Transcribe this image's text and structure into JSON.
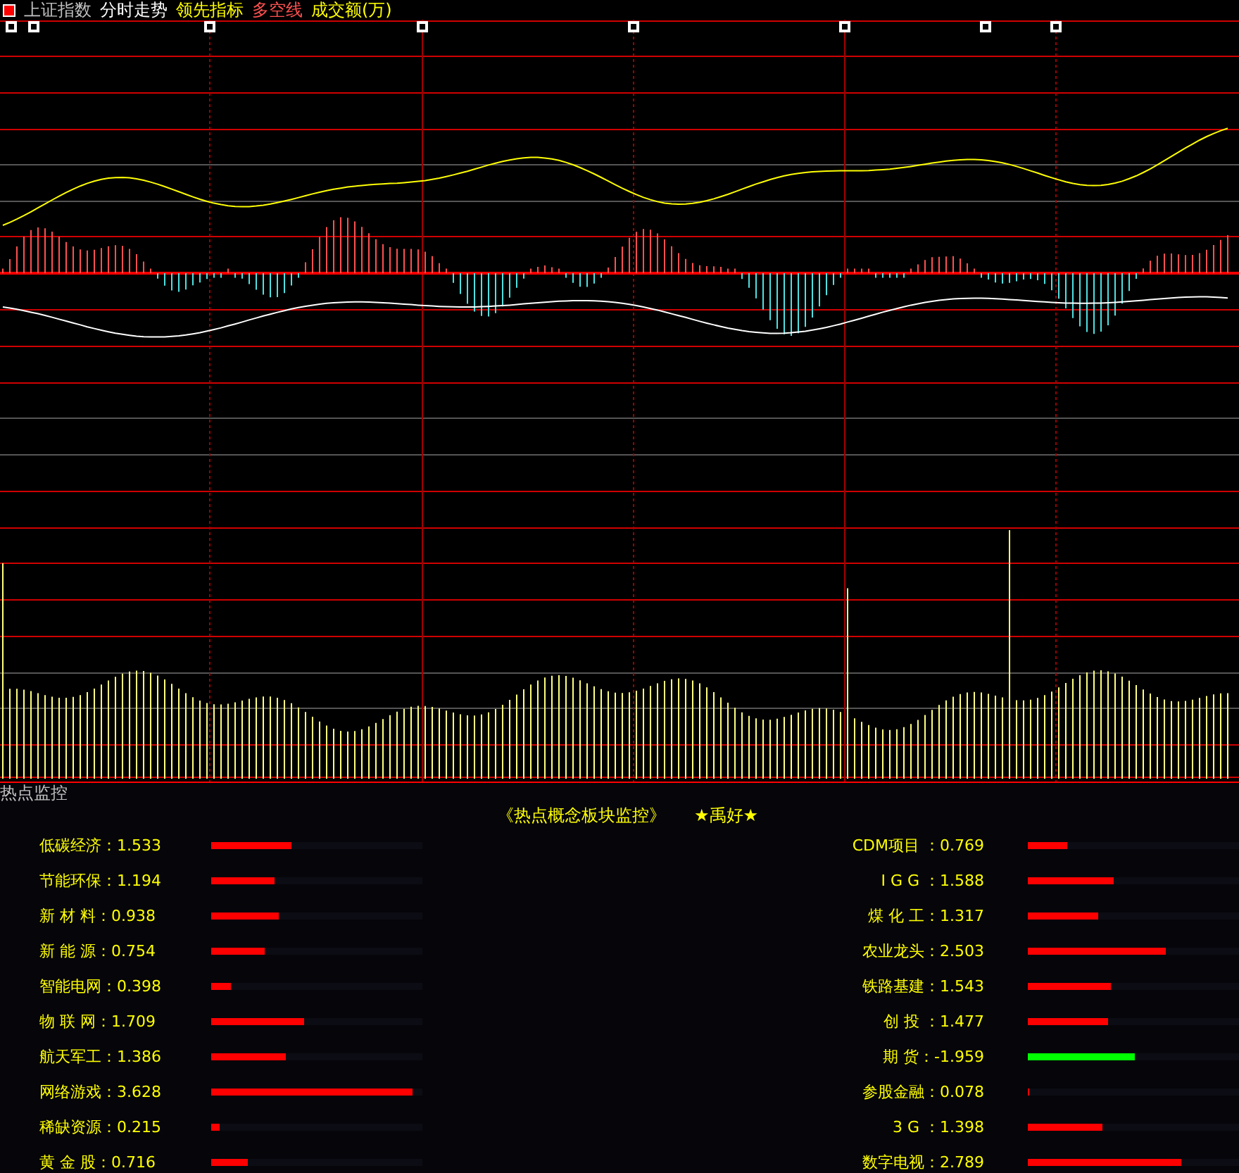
{
  "header": {
    "items": [
      {
        "label": "上证指数",
        "color": "#c0c0c0"
      },
      {
        "label": "分时走势",
        "color": "#ffffff"
      },
      {
        "label": "领先指标",
        "color": "#ffff00"
      },
      {
        "label": "多空线",
        "color": "#ff5050"
      },
      {
        "label": "成交额(万)",
        "color": "#ffff00"
      }
    ]
  },
  "monitor": {
    "title": "热点监控",
    "heading": "《热点概念板块监控》",
    "signature": "★禹好★",
    "left": [
      {
        "text": "低碳经济：1.533",
        "level": 0.383,
        "color": "#ff0000"
      },
      {
        "text": "节能环保：1.194",
        "level": 0.3,
        "color": "#ff0000"
      },
      {
        "text": "新 材 料：0.938",
        "level": 0.32,
        "color": "#ff0000"
      },
      {
        "text": "新 能 源：0.754",
        "level": 0.25,
        "color": "#ff0000"
      },
      {
        "text": "智能电网：0.398",
        "level": 0.093,
        "color": "#ff0000"
      },
      {
        "text": "物 联 网：1.709",
        "level": 0.44,
        "color": "#ff0000"
      },
      {
        "text": "航天军工：1.386",
        "level": 0.353,
        "color": "#ff0000"
      },
      {
        "text": "网络游戏：3.628",
        "level": 0.953,
        "color": "#ff0000"
      },
      {
        "text": "稀缺资源：0.215",
        "level": 0.04,
        "color": "#ff0000"
      },
      {
        "text": "黄 金 股：0.716",
        "level": 0.173,
        "color": "#ff0000"
      }
    ],
    "right": [
      {
        "text": "CDM项目 ：0.769",
        "level": 0.187,
        "color": "#ff0000"
      },
      {
        "text": "I G G ：1.588",
        "level": 0.407,
        "color": "#ff0000"
      },
      {
        "text": "煤 化 工：1.317",
        "level": 0.333,
        "color": "#ff0000"
      },
      {
        "text": "农业龙头：2.503",
        "level": 0.653,
        "color": "#ff0000"
      },
      {
        "text": "铁路基建：1.543",
        "level": 0.393,
        "color": "#ff0000"
      },
      {
        "text": "创 投 ：1.477",
        "level": 0.38,
        "color": "#ff0000"
      },
      {
        "text": "期 货：-1.959",
        "level": 0.507,
        "color": "#00ff00"
      },
      {
        "text": "参股金融：0.078",
        "level": 0.007,
        "color": "#ff0000"
      },
      {
        "text": "3 G ：1.398",
        "level": 0.353,
        "color": "#ff0000"
      },
      {
        "text": "数字电视：2.789",
        "level": 0.727,
        "color": "#ff0000"
      }
    ]
  }
}
